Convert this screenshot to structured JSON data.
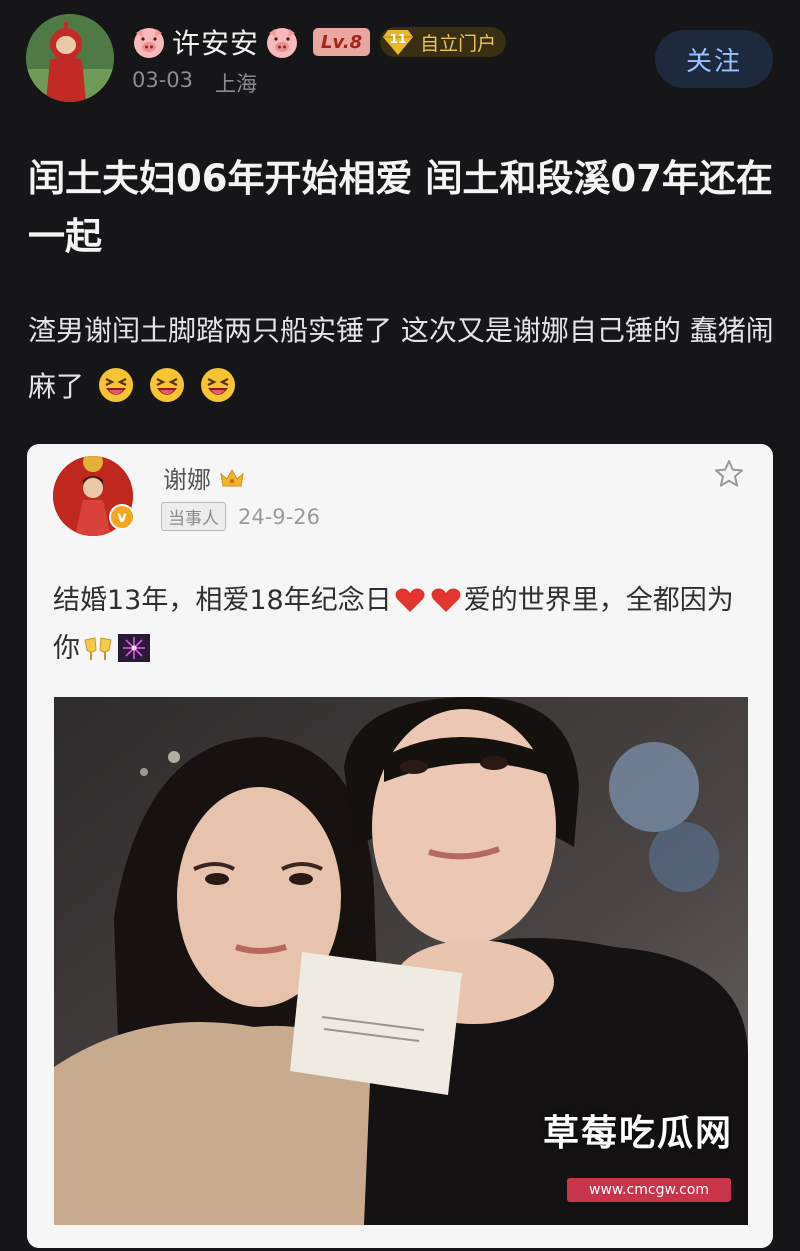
{
  "post": {
    "author": {
      "name": "许安安",
      "level": "Lv.8",
      "fan_badge_level": "11",
      "fan_badge_label": "自立门户",
      "date": "03-03",
      "location": "上海"
    },
    "follow_label": "关注",
    "title": "闰土夫妇06年开始相爱 闰土和段溪07年还在一起",
    "body": "渣男谢闰土脚踏两只船实锤了 这次又是谢娜自己锤的 蠢猪闹麻了"
  },
  "quoted_card": {
    "author_name": "谢娜",
    "role_tag": "当事人",
    "date": "24-9-26",
    "text_part1": "结婚13年，相爱18年纪念日",
    "text_part2": "爱的世界里，全都因为你"
  },
  "watermark": {
    "title": "草莓吃瓜网",
    "url": "www.cmcgw.com"
  },
  "colors": {
    "background": "#161618",
    "follow_text": "#9cc3ff",
    "fan_label": "#e9c65a",
    "level_badge": "#e9a7a0"
  }
}
